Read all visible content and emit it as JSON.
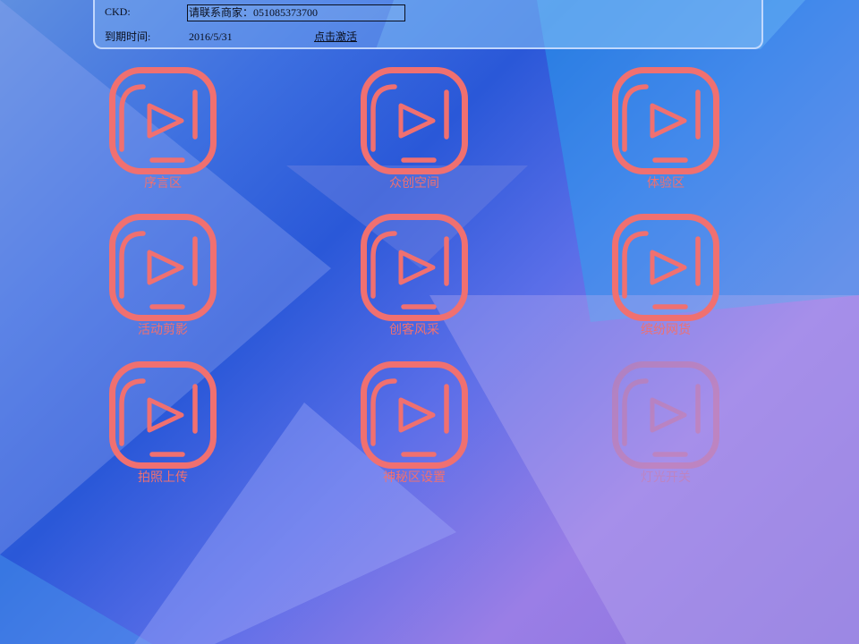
{
  "header": {
    "ckd_label": "CKD:",
    "contact_value": "请联系商家：051085373700",
    "expire_label": "到期时间:",
    "expire_value": "2016/5/31",
    "activate_link": "点击激活"
  },
  "tiles": [
    {
      "label": "序言区",
      "icon": "play-icon"
    },
    {
      "label": "众创空间",
      "icon": "play-icon"
    },
    {
      "label": "体验区",
      "icon": "play-icon"
    },
    {
      "label": "活动剪影",
      "icon": "play-icon"
    },
    {
      "label": "创客风采",
      "icon": "play-icon"
    },
    {
      "label": "缤纷网货",
      "icon": "play-icon"
    },
    {
      "label": "拍照上传",
      "icon": "play-icon"
    },
    {
      "label": "神秘区设置",
      "icon": "play-icon"
    },
    {
      "label": "灯光开关",
      "icon": "play-icon",
      "disabled": true
    }
  ],
  "colors": {
    "icon_accent": "#f07070",
    "header_text": "#0a0f1e"
  }
}
